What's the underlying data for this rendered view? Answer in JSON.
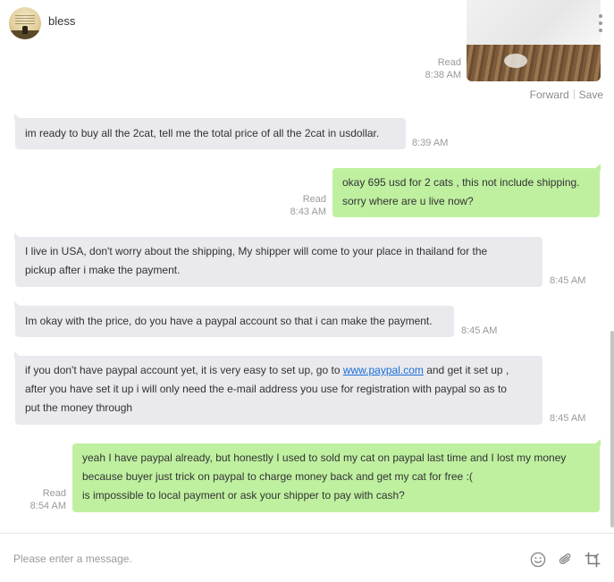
{
  "contact": {
    "name": "bless"
  },
  "photo_message": {
    "status": "Read",
    "time": "8:38 AM",
    "actions": {
      "forward": "Forward",
      "save": "Save"
    }
  },
  "messages": [
    {
      "direction": "in",
      "text": "im ready to buy all the 2cat, tell me the total price of all the 2cat in usdollar.",
      "time": "8:39 AM"
    },
    {
      "direction": "out",
      "line1": "okay 695 usd for 2 cats , this not include shipping.",
      "line2": "sorry where are u live now?",
      "status": "Read",
      "time": "8:43 AM"
    },
    {
      "direction": "in",
      "line1": "I live in USA, don't worry about the shipping, My shipper will come to your place in thailand for the",
      "line2": "pickup after i make the payment.",
      "time": "8:45 AM"
    },
    {
      "direction": "in",
      "text": "Im okay with the price, do you have a paypal account so that i can make the payment.",
      "time": "8:45 AM"
    },
    {
      "direction": "in",
      "line1_before": "if you don't have paypal account yet, it is very easy to set up, go to ",
      "link": "www.paypal.com",
      "line1_after": " and get it set up ,",
      "line2": "after you have set it up i will only need the e-mail address you use for registration with paypal so as to",
      "line3": "put the money through",
      "time": "8:45 AM"
    },
    {
      "direction": "out",
      "line1": "yeah I have paypal already, but honestly I used to sold my cat on paypal last time and I lost my money",
      "line2": "because buyer just trick on paypal to charge money back and get my cat for free :(",
      "line3": "is impossible to local payment or ask your shipper to pay with cash?",
      "status": "Read",
      "time": "8:54 AM"
    }
  ],
  "composer": {
    "placeholder": "Please enter a message.",
    "icons": [
      "emoji-icon",
      "attachment-icon",
      "crop-icon"
    ]
  },
  "colors": {
    "incoming_bubble": "#e9e9ee",
    "outgoing_bubble": "#bff0a0",
    "link": "#1a6fd6"
  }
}
